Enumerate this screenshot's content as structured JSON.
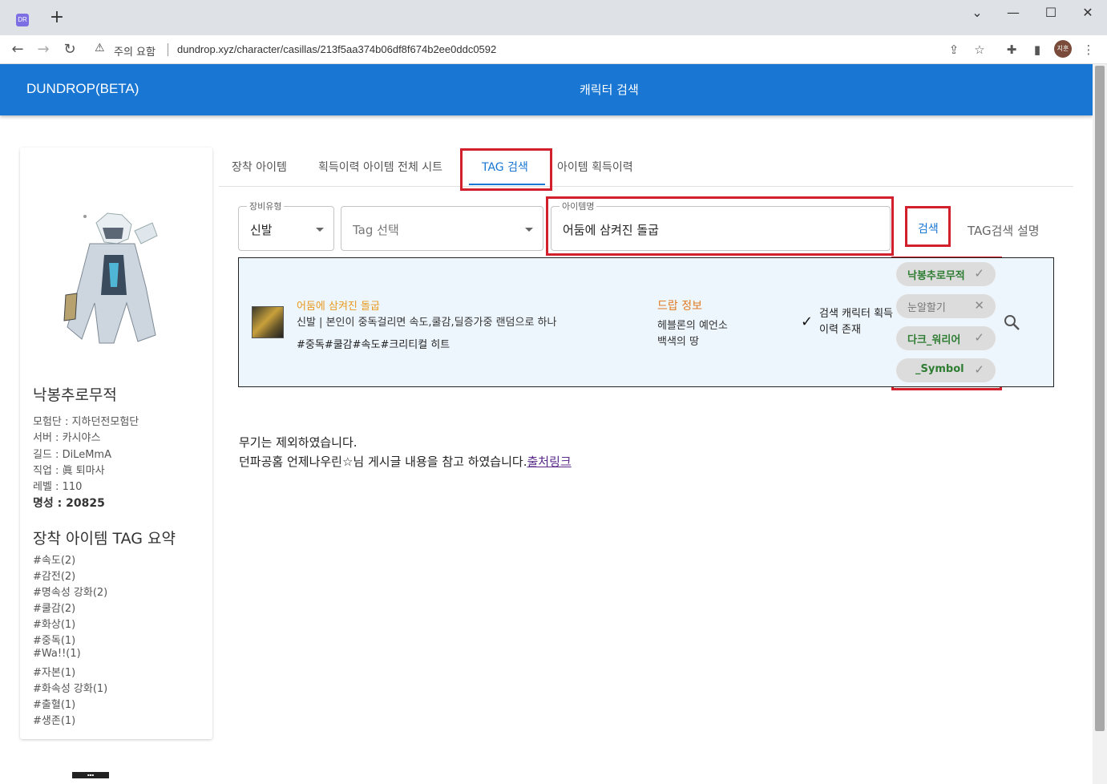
{
  "browser": {
    "favicon_text": "DR",
    "new_tab": "+",
    "security_warning": "주의 요함",
    "url": "dundrop.xyz/character/casillas/213f5aa374b06df8f674b2ee0ddc0592",
    "profile_initials": "지훈"
  },
  "header": {
    "brand": "DUNDROP(BETA)",
    "page_title": "캐릭터 검색"
  },
  "profile": {
    "name": "낙봉추로무적",
    "adventure_team": "모험단 : 지하던전모험단",
    "server": "서버 : 카시야스",
    "guild": "길드 : DiLeMmA",
    "job": "직업 : 眞 퇴마사",
    "level": "레벨 : 110",
    "fame": "명성 : 20825",
    "tag_summary_title": "장착 아이템 TAG 요약",
    "tag_summary": [
      "#속도(2)",
      "#감전(2)",
      "#명속성 강화(2)",
      "#쿨감(2)",
      "#화상(1)",
      "#중독(1)",
      "#Wa!!(1)",
      "#자본(1)",
      "#화속성 강화(1)",
      "#출혈(1)",
      "#생존(1)"
    ]
  },
  "tabs": [
    {
      "label": "장착 아이템"
    },
    {
      "label": "획득이력 아이템 전체 시트"
    },
    {
      "label": "TAG 검색"
    },
    {
      "label": "아이템 획득이력"
    }
  ],
  "active_tab": "TAG 검색",
  "form": {
    "equip_type_label": "장비유형",
    "equip_type_value": "신발",
    "tag_placeholder": "Tag 선택",
    "item_name_label": "아이템명",
    "item_name_value": "어둠에 삼켜진 돌굽",
    "search_button": "검색",
    "help_button": "TAG검색 설명"
  },
  "result": {
    "item_name": "어둠에 삼켜진 돌굽",
    "item_desc": "신발 | 본인이 중독걸리면 속도,쿨감,딜증가중 랜덤으로 하나",
    "item_tags": "#중독#쿨감#속도#크리티컬 히트",
    "drop_title": "드랍 정보",
    "drop_lines": [
      "헤블론의 예언소",
      "백색의 땅"
    ],
    "history_check": "검색 캐릭터 획득이력 존재",
    "characters": [
      {
        "name": "낙봉추로무적",
        "acquired": true
      },
      {
        "name": "눈알할기",
        "acquired": false
      },
      {
        "name": "다크_워리어",
        "acquired": true
      },
      {
        "name": "_Symbol",
        "acquired": true
      }
    ]
  },
  "notes": {
    "line1": "무기는 제외하였습니다.",
    "line2": "던파공홈 언제나우린☆님 게시글 내용을 참고 하였습니다.",
    "link": "출처링크"
  },
  "colors": {
    "primary": "#1976d2",
    "highlight_box": "#d1202b",
    "item_name": "#e89a1e",
    "drop_title": "#e07b22",
    "acquired_chip_text": "#2e7d32"
  }
}
